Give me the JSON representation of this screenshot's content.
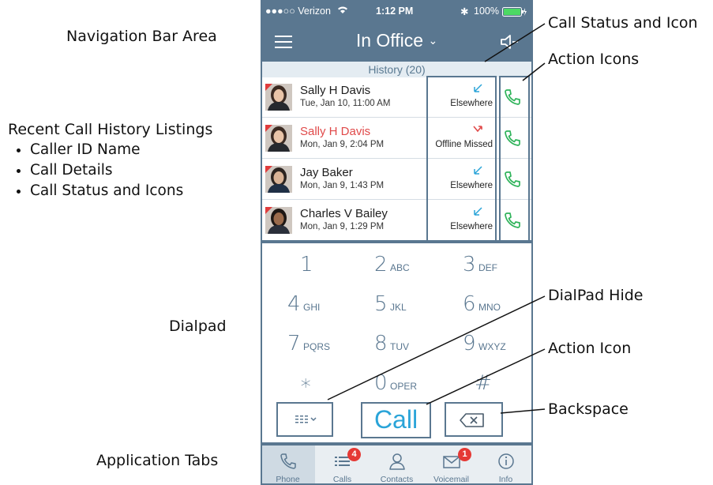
{
  "annotations": {
    "navigation_bar_area": "Navigation Bar Area",
    "recent_call_history": "Recent Call History Listings",
    "bullets": [
      "Caller ID Name",
      "Call Details",
      "Call Status and Icons"
    ],
    "dialpad": "Dialpad",
    "application_tabs": "Application Tabs",
    "call_status_and_icon": "Call Status and Icon",
    "action_icons": "Action Icons",
    "dialpad_hide": "DialPad Hide",
    "action_icon": "Action Icon",
    "backspace": "Backspace"
  },
  "status_bar": {
    "carrier": "●●●○○ Verizon",
    "time": "1:12 PM",
    "battery": "100%"
  },
  "nav_bar": {
    "title": "In Office",
    "menu_icon": "hamburger-icon",
    "speaker_icon": "speaker-icon"
  },
  "history": {
    "header": "History (20)",
    "calls": [
      {
        "name": "Sally H Davis",
        "detail": "Tue, Jan 10, 11:00 AM",
        "status": "Elsewhere",
        "missed": false
      },
      {
        "name": "Sally H Davis",
        "detail": "Mon, Jan 9, 2:04 PM",
        "status": "Offline Missed",
        "missed": true
      },
      {
        "name": "Jay Baker",
        "detail": "Mon, Jan 9, 1:43 PM",
        "status": "Elsewhere",
        "missed": false
      },
      {
        "name": "Charles V Bailey",
        "detail": "Mon, Jan 9, 1:29 PM",
        "status": "Elsewhere",
        "missed": false
      }
    ]
  },
  "dialpad": {
    "keys": [
      {
        "digit": "1",
        "letters": ""
      },
      {
        "digit": "2",
        "letters": "ABC"
      },
      {
        "digit": "3",
        "letters": "DEF"
      },
      {
        "digit": "4",
        "letters": "GHI"
      },
      {
        "digit": "5",
        "letters": "JKL"
      },
      {
        "digit": "6",
        "letters": "MNO"
      },
      {
        "digit": "7",
        "letters": "PQRS"
      },
      {
        "digit": "8",
        "letters": "TUV"
      },
      {
        "digit": "9",
        "letters": "WXYZ"
      },
      {
        "digit": "∗",
        "letters": ""
      },
      {
        "digit": "0",
        "letters": "OPER"
      },
      {
        "digit": "#",
        "letters": ""
      }
    ],
    "call_label": "Call"
  },
  "tabs": [
    {
      "label": "Phone",
      "badge": "",
      "active": true
    },
    {
      "label": "Calls",
      "badge": "4",
      "active": false
    },
    {
      "label": "Contacts",
      "badge": "",
      "active": false
    },
    {
      "label": "Voicemail",
      "badge": "1",
      "active": false
    },
    {
      "label": "Info",
      "badge": "",
      "active": false
    }
  ],
  "colors": {
    "nav": "#5a7790",
    "call_blue": "#2aa4d8",
    "call_green": "#2fb35a",
    "missed_red": "#e04a4a",
    "badge_red": "#e53935"
  }
}
